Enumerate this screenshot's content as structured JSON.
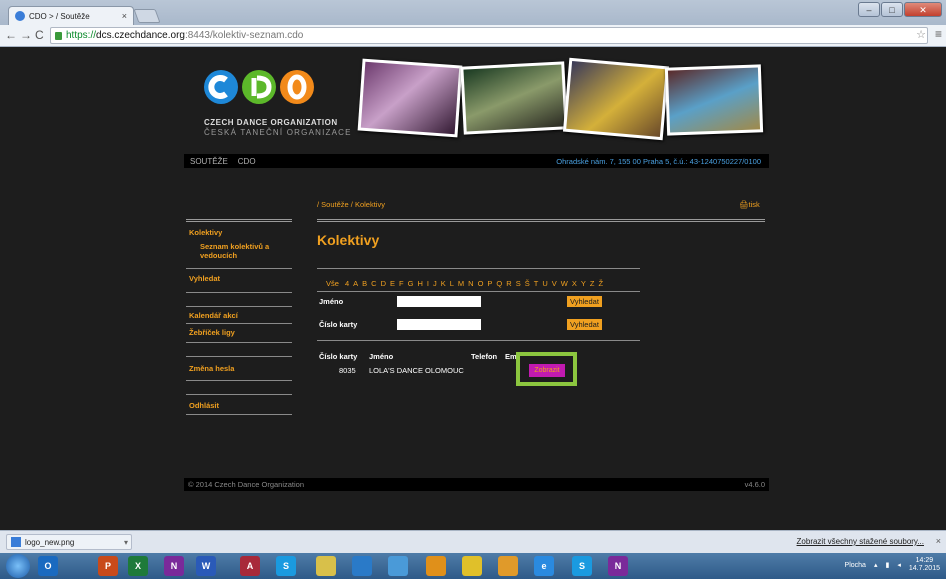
{
  "browser": {
    "tab_title": "CDO > / Soutěže",
    "tab_close": "×",
    "url_https": "https://",
    "url_domain": "dcs.czechdance.org",
    "url_path": ":8443/kolektiv-seznam.cdo"
  },
  "site": {
    "org_name_en": "CZECH DANCE ORGANIZATION",
    "org_name_cz": "ČESKÁ TANEČNÍ ORGANIZACE",
    "nav": [
      "SOUTĚŽE",
      "CDO"
    ],
    "address": "Ohradské nám. 7, 155 00 Praha 5, č.ú.: 43-1240750227/0100",
    "brand_colors": {
      "blue": "#1e88d8",
      "green": "#5cb82a",
      "orange": "#f28a1a"
    }
  },
  "breadcrumb": "/ Soutěže / Kolektivy",
  "print_label": "tisk",
  "sidebar": {
    "items": [
      {
        "label": "Kolektivy"
      },
      {
        "label": "Seznam kolektivů a vedoucích"
      },
      {
        "label": "Vyhledat"
      },
      {
        "label": "Kalendář akcí"
      },
      {
        "label": "Žebříček ligy"
      },
      {
        "label": "Změna hesla"
      },
      {
        "label": "Odhlásit"
      }
    ]
  },
  "heading": "Kolektivy",
  "alphabet": {
    "all": "Vše",
    "letters": [
      "4",
      "A",
      "B",
      "C",
      "D",
      "E",
      "F",
      "G",
      "H",
      "I",
      "J",
      "K",
      "L",
      "M",
      "N",
      "O",
      "P",
      "Q",
      "R",
      "S",
      "Š",
      "T",
      "U",
      "V",
      "W",
      "X",
      "Y",
      "Z",
      "Ž"
    ]
  },
  "search": {
    "name_label": "Jméno",
    "name_value": "",
    "card_label": "Číslo karty",
    "card_value": "",
    "button_label": "Vyhledat"
  },
  "table": {
    "columns": [
      "Číslo karty",
      "Jméno",
      "Telefon",
      "Email"
    ],
    "rows": [
      {
        "card": "8035",
        "name": "LOLA'S DANCE OLOMOUC",
        "phone": "",
        "email": "",
        "action": "Zobrazit"
      }
    ]
  },
  "footer": {
    "copyright": "© 2014 Czech Dance Organization",
    "version": "v4.6.0"
  },
  "download_bar": {
    "file": "logo_new.png",
    "show_all": "Zobrazit všechny stažené soubory...",
    "close": "×"
  },
  "taskbar": {
    "desktop_label": "Plocha",
    "time": "14:29",
    "date": "14.7.2015"
  }
}
